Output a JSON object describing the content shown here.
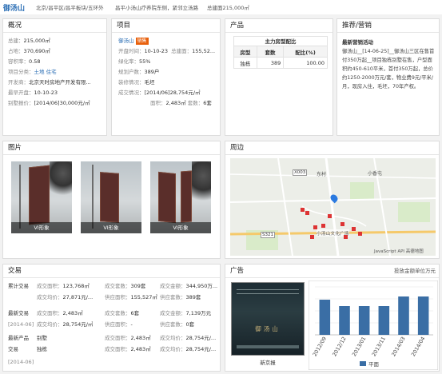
{
  "header": {
    "title": "御汤山",
    "location": "北京/昌平区/昌平板块/五环外",
    "address": "昌平小汤山疗养院东侧，紧邻立汤路",
    "total_price": "总建面215,000㎡"
  },
  "overview": {
    "title": "概况",
    "items": [
      {
        "label": "总建：",
        "value": "215,000㎡"
      },
      {
        "label": "占地：",
        "value": "370,690㎡"
      },
      {
        "label": "容积率：",
        "value": "0.58"
      },
      {
        "label": "项目分类：",
        "value": "土地 住宅"
      },
      {
        "label": "开发商：",
        "value": "北京天时房地产开发有限..."
      },
      {
        "label": "最早开盘：",
        "value": "10-10-23"
      },
      {
        "label": "别墅报价：",
        "value": "[2014/06]30,000元/㎡"
      }
    ]
  },
  "project": {
    "title": "项目",
    "name": "御汤山",
    "badge": "销售",
    "open_label": "开盘时间：",
    "open_value": "10-10-23",
    "total_label": "总建面：",
    "total_value": "155,52...",
    "green_label": "绿化率：",
    "green_value": "55%",
    "households_label": "规划户数：",
    "households_value": "389户",
    "decor_label": "装修情况：",
    "decor_value": "毛坯",
    "deal_label": "成交情况：",
    "deal_value": "[2014/06]28,754元/㎡",
    "area_label": "面积：",
    "area_value": "2,483㎡",
    "sets_label": "套数：",
    "sets_value": "6套"
  },
  "product": {
    "title": "产品",
    "table_title": "主力房型配比",
    "headers": [
      "房型",
      "套数",
      "配比(%)"
    ],
    "rows": [
      [
        "独栋",
        "389",
        "100.00"
      ]
    ]
  },
  "promo": {
    "title": "推荐/营销",
    "subtitle": "最新营销活动",
    "text": "御汤山__[14-06-25]__御汤山三区在售首付350万起__项目独栋别墅在售，户型面积约450-610平米，首付350万起，总价约1250-2000万元/套，物业费9元/平米/月，现房入住，毛坯，70年产权。"
  },
  "pictures": {
    "title": "图片",
    "captions": [
      "VI形象",
      "VI形象",
      "VI形象"
    ]
  },
  "surround": {
    "title": "周边",
    "labels": [
      "X003",
      "东村",
      "小香屯",
      "小汤山文化广场",
      "S321",
      "JavaScript API",
      "高德地图"
    ]
  },
  "trade": {
    "title": "交易",
    "rows": [
      {
        "c1": "累计交易",
        "c2l": "成交面积：",
        "c2v": "123,768㎡",
        "c3l": "成交套数：",
        "c3v": "309套",
        "c4l": "成交金额：",
        "c4v": "344,950万..."
      },
      {
        "c1": "",
        "c2l": "成交均价：",
        "c2v": "27,871元/...",
        "c3l": "供应面积：",
        "c3v": "155,527㎡",
        "c4l": "供应套数：",
        "c4v": "389套"
      },
      {
        "c1": "最新交易",
        "c2l": "成交面积：",
        "c2v": "2,483㎡",
        "c3l": "成交套数：",
        "c3v": "6套",
        "c4l": "成交金额：",
        "c4v": "7,139万元"
      },
      {
        "c1": "[2014-06]",
        "c2l": "成交均价：",
        "c2v": "28,754元/㎡",
        "c3l": "供应面积：",
        "c3v": "-",
        "c4l": "供应套数：",
        "c4v": "0套"
      },
      {
        "c1": "最新产品",
        "c2l": "别墅",
        "c3l": "成交面积：",
        "c3v": "2,483㎡",
        "c4l": "成交均价：",
        "c4v": "28,754元/..."
      },
      {
        "c1": "交易",
        "c2l": "独栋",
        "c3l": "成交面积：",
        "c3v": "2,483㎡",
        "c4l": "成交均价：",
        "c4v": "28,754元/..."
      },
      {
        "c1": "[2014-06]"
      }
    ]
  },
  "ads": {
    "title": "广告",
    "link": "投放金额单位万元",
    "ad_caption": "新京报",
    "ad_logo": "御汤山"
  },
  "chart_data": {
    "type": "bar",
    "categories": [
      "2012/09",
      "2012/12",
      "2013/01",
      "2013/11",
      "2014/03",
      "2014/04"
    ],
    "series": [
      {
        "name": "平面",
        "values": [
          22,
          18,
          18,
          18,
          24,
          24
        ]
      }
    ],
    "ylim": [
      0,
      30
    ],
    "bar_color": "#3a6ea5"
  }
}
